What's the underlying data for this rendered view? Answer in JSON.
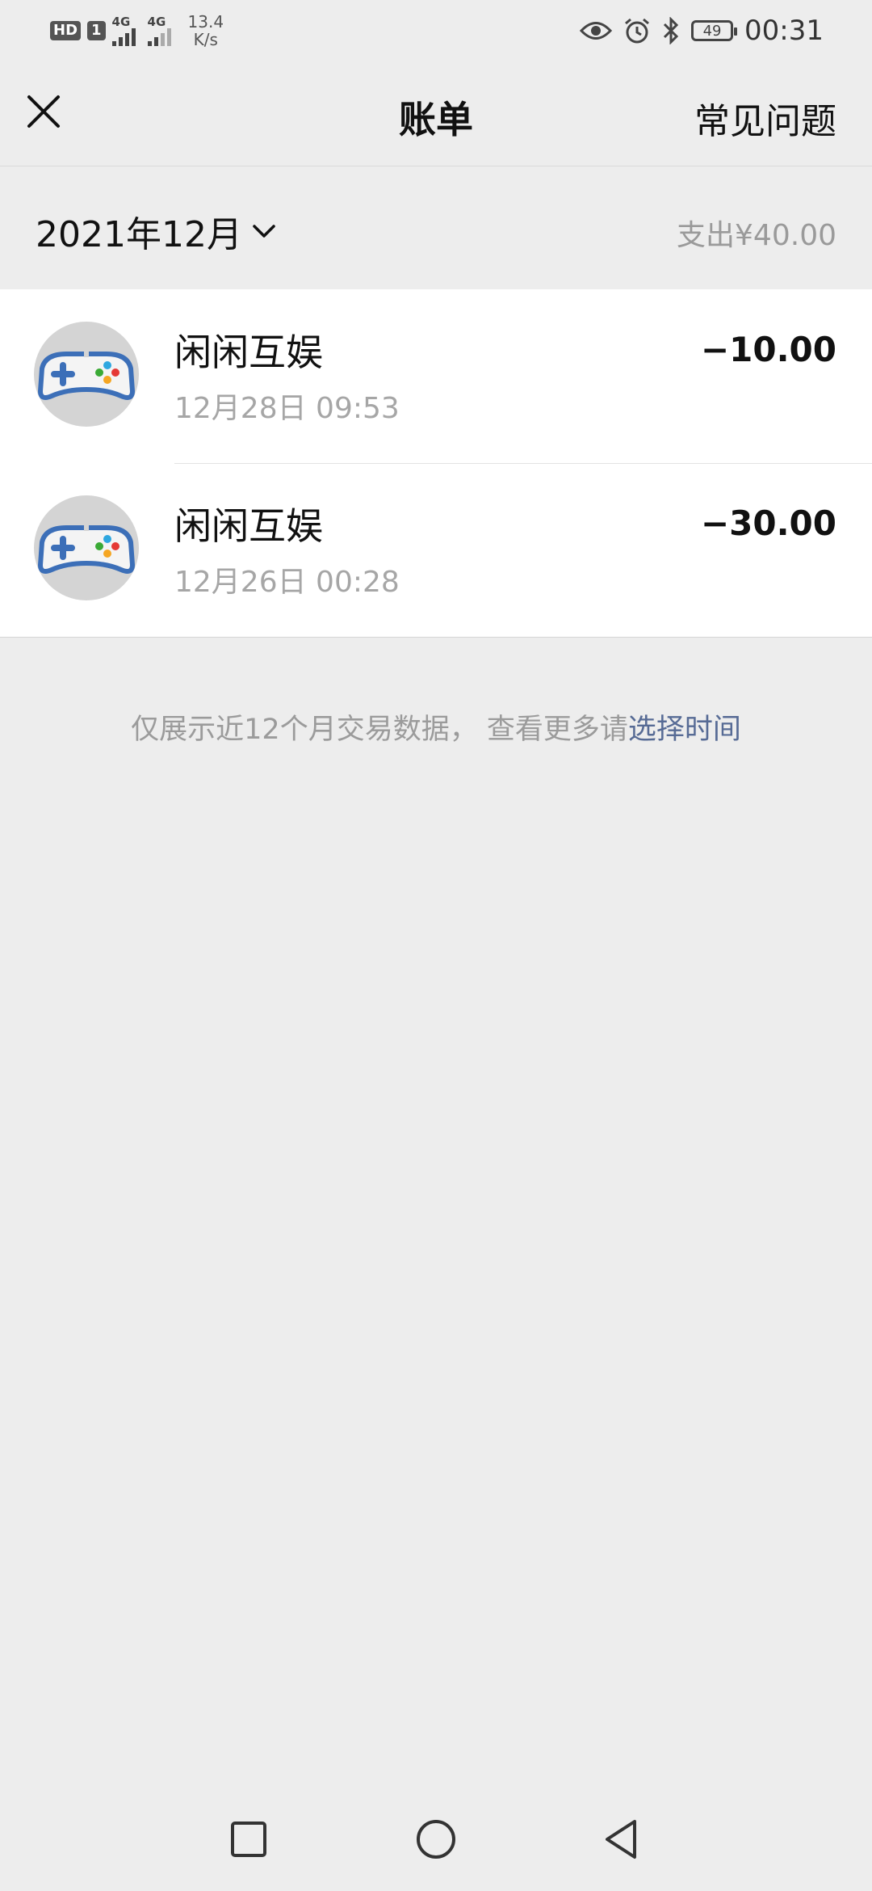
{
  "status_bar": {
    "hd": "HD",
    "sim": "1",
    "net1": "4G",
    "net2": "4G",
    "speed_value": "13.4",
    "speed_unit": "K/s",
    "battery": "49",
    "time": "00:31",
    "icons": [
      "eye-icon",
      "alarm-icon",
      "bluetooth-icon",
      "battery-icon"
    ]
  },
  "header": {
    "title": "账单",
    "faq_label": "常见问题"
  },
  "month_bar": {
    "month": "2021年12月",
    "total": "支出¥40.00"
  },
  "transactions": [
    {
      "merchant": "闲闲互娱",
      "datetime": "12月28日 09:53",
      "amount": "−10.00"
    },
    {
      "merchant": "闲闲互娱",
      "datetime": "12月26日 00:28",
      "amount": "−30.00"
    }
  ],
  "notice": {
    "text": "仅展示近12个月交易数据， 查看更多请",
    "link": "选择时间"
  },
  "colors": {
    "background": "#ededed",
    "link": "#576b95",
    "avatar_blue": "#3c6fb8"
  }
}
